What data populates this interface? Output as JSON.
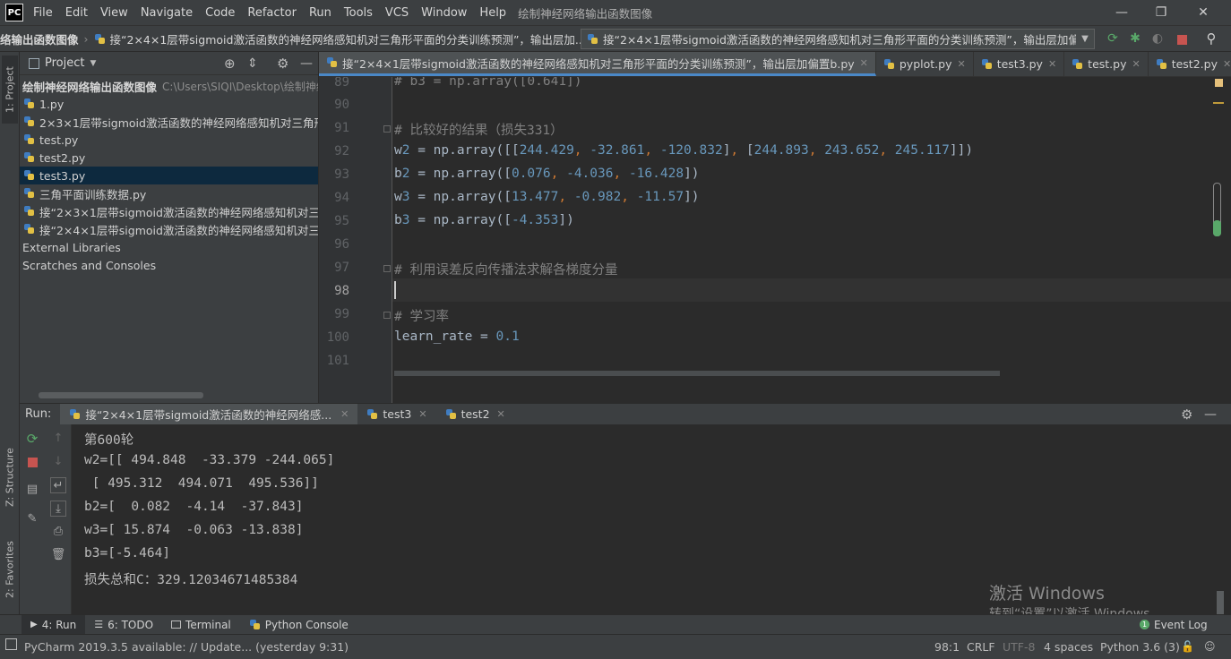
{
  "app": {
    "logo_text": "PC",
    "window_title": "绘制神经网络输出函数图像"
  },
  "menu": [
    "File",
    "Edit",
    "View",
    "Navigate",
    "Code",
    "Refactor",
    "Run",
    "Tools",
    "VCS",
    "Window",
    "Help"
  ],
  "window_controls": {
    "minimize": "—",
    "maximize": "❐",
    "close": "✕"
  },
  "navbar": {
    "breadcrumb": [
      "络输出函数图像",
      "接“2×4×1层带sigmoid激活函数的神经网络感知机对三角形平面的分类训练预测”，输出层加..."
    ],
    "run_config": "接“2×4×1层带sigmoid激活函数的神经网络感知机对三角形平面的分类训练预测”，输出层加偏置b"
  },
  "left_stripe": {
    "project_tab": "1: Project",
    "structure_tab": "Z: Structure",
    "favorites_tab": "2: Favorites"
  },
  "project": {
    "title": "Project",
    "root": {
      "name": "绘制神经网络输出函数图像",
      "path": "C:\\Users\\SIQI\\Desktop\\绘制神经"
    },
    "files": [
      "1.py",
      "2×3×1层带sigmoid激活函数的神经网络感知机对三角形平",
      "test.py",
      "test2.py",
      "test3.py",
      "三角平面训练数据.py",
      "接“2×3×1层带sigmoid激活函数的神经网络感知机对三角形",
      "接“2×4×1层带sigmoid激活函数的神经网络感知机对三角形"
    ],
    "selected_index": 4,
    "extra": [
      "External Libraries",
      "Scratches and Consoles"
    ]
  },
  "editor_tabs": [
    {
      "label": "接“2×4×1层带sigmoid激活函数的神经网络感知机对三角形平面的分类训练预测”，输出层加偏置b.py",
      "active": true
    },
    {
      "label": "pyplot.py",
      "active": false
    },
    {
      "label": "test3.py",
      "active": false
    },
    {
      "label": "test.py",
      "active": false
    },
    {
      "label": "test2.py",
      "active": false
    }
  ],
  "editor_tabs_overflow": "≡2",
  "editor": {
    "line_numbers": [
      "89",
      "90",
      "91",
      "92",
      "93",
      "94",
      "95",
      "96",
      "97",
      "98",
      "99",
      "100",
      "101"
    ],
    "lines": [
      "# b3 = np.array([0.641])",
      "",
      "# 比较好的结果（损失331）",
      "w2 = np.array([[244.429, -32.861, -120.832], [244.893, 243.652, 245.117]])",
      "b2 = np.array([0.076, -4.036, -16.428])",
      "w3 = np.array([13.477, -0.982, -11.57])",
      "b3 = np.array([-4.353])",
      "",
      "# 利用误差反向传播法求解各梯度分量",
      "",
      "# 学习率",
      "learn_rate = 0.1",
      ""
    ],
    "caret_line": "98"
  },
  "run": {
    "label": "Run:",
    "tabs": [
      {
        "label": "接“2×4×1层带sigmoid激活函数的神经网络感...",
        "active": true
      },
      {
        "label": "test3",
        "active": false
      },
      {
        "label": "test2",
        "active": false
      }
    ],
    "console": [
      "第600轮",
      "w2=[[ 494.848  -33.379 -244.065]",
      " [ 495.312  494.071  495.536]]",
      "b2=[  0.082  -4.14  -37.843]",
      "w3=[ 15.874  -0.063 -13.838]",
      "b3=[-5.464]",
      "损失总和C：329.12034671485384"
    ]
  },
  "watermark": {
    "line1": "激活 Windows",
    "line2": "转到“设置”以激活 Windows。"
  },
  "bottom_tabs": [
    "4: Run",
    "6: TODO",
    "Terminal",
    "Python Console"
  ],
  "event_log": "Event Log",
  "statusbar": {
    "message": "PyCharm 2019.3.5 available: // Update... (yesterday 9:31)",
    "position": "98:1",
    "line_sep": "CRLF",
    "encoding": "UTF-8",
    "indent": "4 spaces",
    "interpreter": "Python 3.6 (3)"
  }
}
